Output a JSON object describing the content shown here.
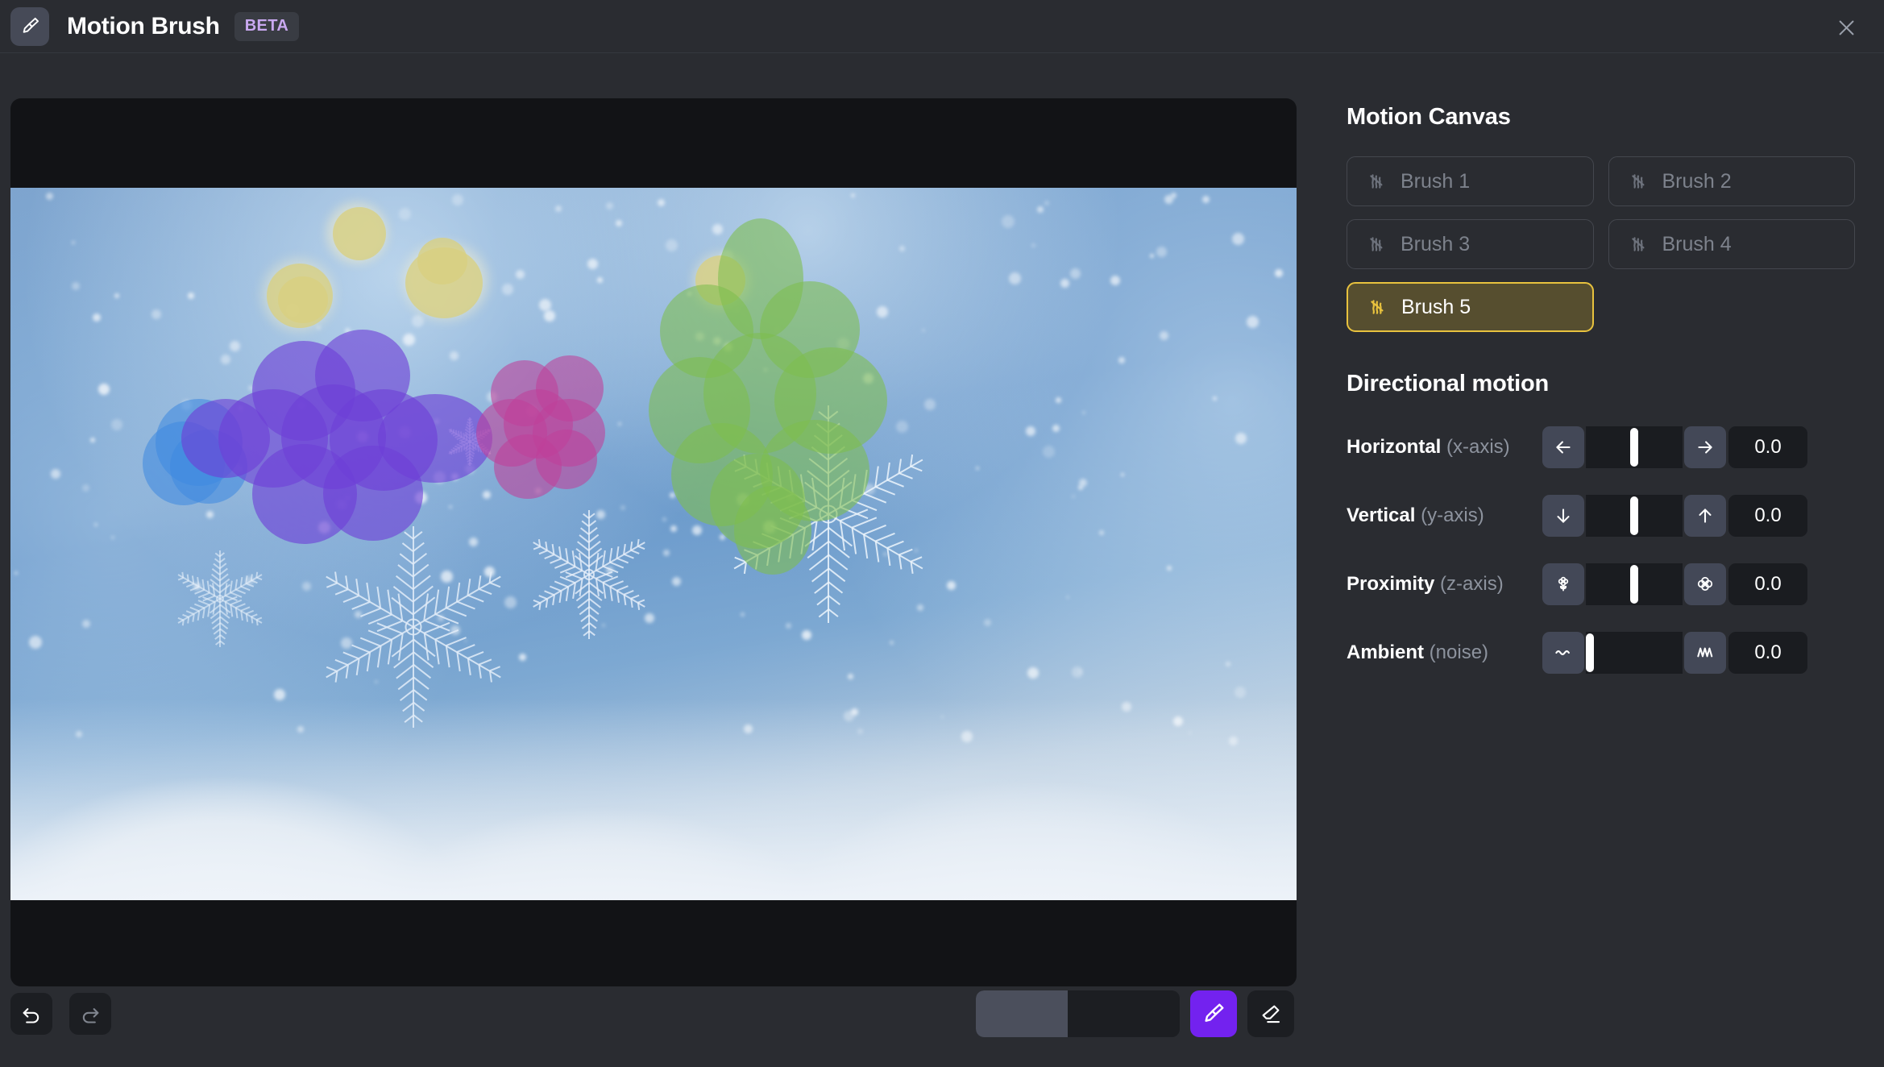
{
  "header": {
    "app_icon": "paintbrush-icon",
    "title": "Motion Brush",
    "badge": "BETA",
    "close_icon": "close-icon"
  },
  "canvas": {
    "name": "motion-canvas-preview",
    "scene_description": "winter snowflakes macro photo on snow bank with blue sky and bokeh",
    "masks": [
      {
        "brush": "Brush 5",
        "color": "#d9cf80",
        "name": "yellow-mask"
      },
      {
        "brush": "Brush 1",
        "color": "#3f8ae0",
        "name": "blue-mask"
      },
      {
        "brush": "Brush 2",
        "color": "#6d3fd6",
        "name": "purple-mask"
      },
      {
        "brush": "Brush 3",
        "color": "#c0409a",
        "name": "pink-mask"
      },
      {
        "brush": "Brush 4",
        "color": "#7dbe4e",
        "name": "green-mask"
      }
    ]
  },
  "toolbar": {
    "undo_label": "Undo",
    "undo_icon": "undo-arrow-icon",
    "undo_enabled": true,
    "redo_label": "Redo",
    "redo_icon": "redo-arrow-icon",
    "redo_enabled": false,
    "brush_size_percent": 45,
    "brush_tool_icon": "paintbrush-icon",
    "brush_tool_active": true,
    "brush_tool_color": "#7322ef",
    "eraser_tool_icon": "eraser-icon",
    "eraser_tool_active": false
  },
  "panel": {
    "motion_canvas_title": "Motion Canvas",
    "brushes": [
      {
        "label": "Brush 1",
        "selected": false,
        "icon": "scribble-icon"
      },
      {
        "label": "Brush 2",
        "selected": false,
        "icon": "scribble-icon"
      },
      {
        "label": "Brush 3",
        "selected": false,
        "icon": "scribble-icon"
      },
      {
        "label": "Brush 4",
        "selected": false,
        "icon": "scribble-icon"
      },
      {
        "label": "Brush 5",
        "selected": true,
        "icon": "scribble-icon"
      }
    ],
    "selected_brush_border_color": "#e8c23e",
    "selected_brush_bg_color": "#564e2f",
    "directional_motion_title": "Directional motion",
    "motion_rows": [
      {
        "name": "horizontal",
        "label": "Horizontal",
        "axis": "(x-axis)",
        "dec_icon": "arrow-left-icon",
        "inc_icon": "arrow-right-icon",
        "value": "0.0",
        "slider_percent": 50
      },
      {
        "name": "vertical",
        "label": "Vertical",
        "axis": "(y-axis)",
        "dec_icon": "arrow-down-icon",
        "inc_icon": "arrow-up-icon",
        "value": "0.0",
        "slider_percent": 50
      },
      {
        "name": "proximity",
        "label": "Proximity",
        "axis": "(z-axis)",
        "dec_icon": "flower-small-icon",
        "inc_icon": "flower-large-icon",
        "value": "0.0",
        "slider_percent": 50
      },
      {
        "name": "ambient",
        "label": "Ambient",
        "axis": "(noise)",
        "dec_icon": "wave-low-icon",
        "inc_icon": "wave-high-icon",
        "value": "0.0",
        "slider_percent": 0
      }
    ]
  }
}
